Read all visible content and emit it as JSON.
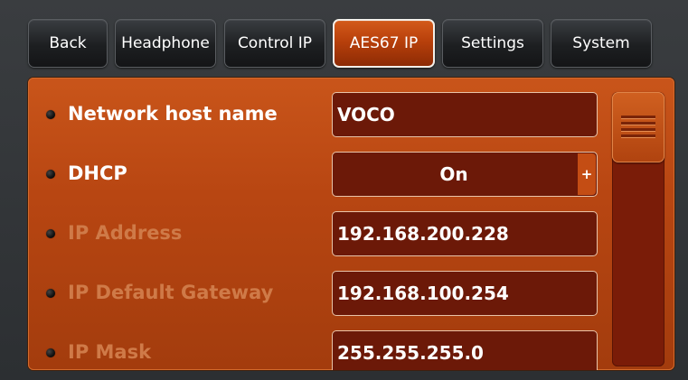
{
  "tabs": [
    {
      "label": "Back",
      "active": false
    },
    {
      "label": "Headphone",
      "active": false
    },
    {
      "label": "Control IP",
      "active": false
    },
    {
      "label": "AES67 IP",
      "active": true
    },
    {
      "label": "Settings",
      "active": false
    },
    {
      "label": "System",
      "active": false
    }
  ],
  "settings": [
    {
      "label": "Network host name",
      "value": "VOCO",
      "enabled": true
    },
    {
      "label": "DHCP",
      "value": "On",
      "enabled": true,
      "control_symbol": "+"
    },
    {
      "label": "IP Address",
      "value": "192.168.200.228",
      "enabled": false
    },
    {
      "label": "IP Default Gateway",
      "value": "192.168.100.254",
      "enabled": false
    },
    {
      "label": "IP Mask",
      "value": "255.255.255.0",
      "enabled": false
    }
  ],
  "scroll_position": 0,
  "colors": {
    "accent": "#b84612",
    "field_bg": "#6c1908",
    "tab_bg": "#1d1f21",
    "frame_bg": "#2f3235"
  },
  "icons": {
    "bullet": "bullet-dot-icon",
    "scroll_grip": "grip-lines-icon",
    "increment": "plus-icon"
  }
}
